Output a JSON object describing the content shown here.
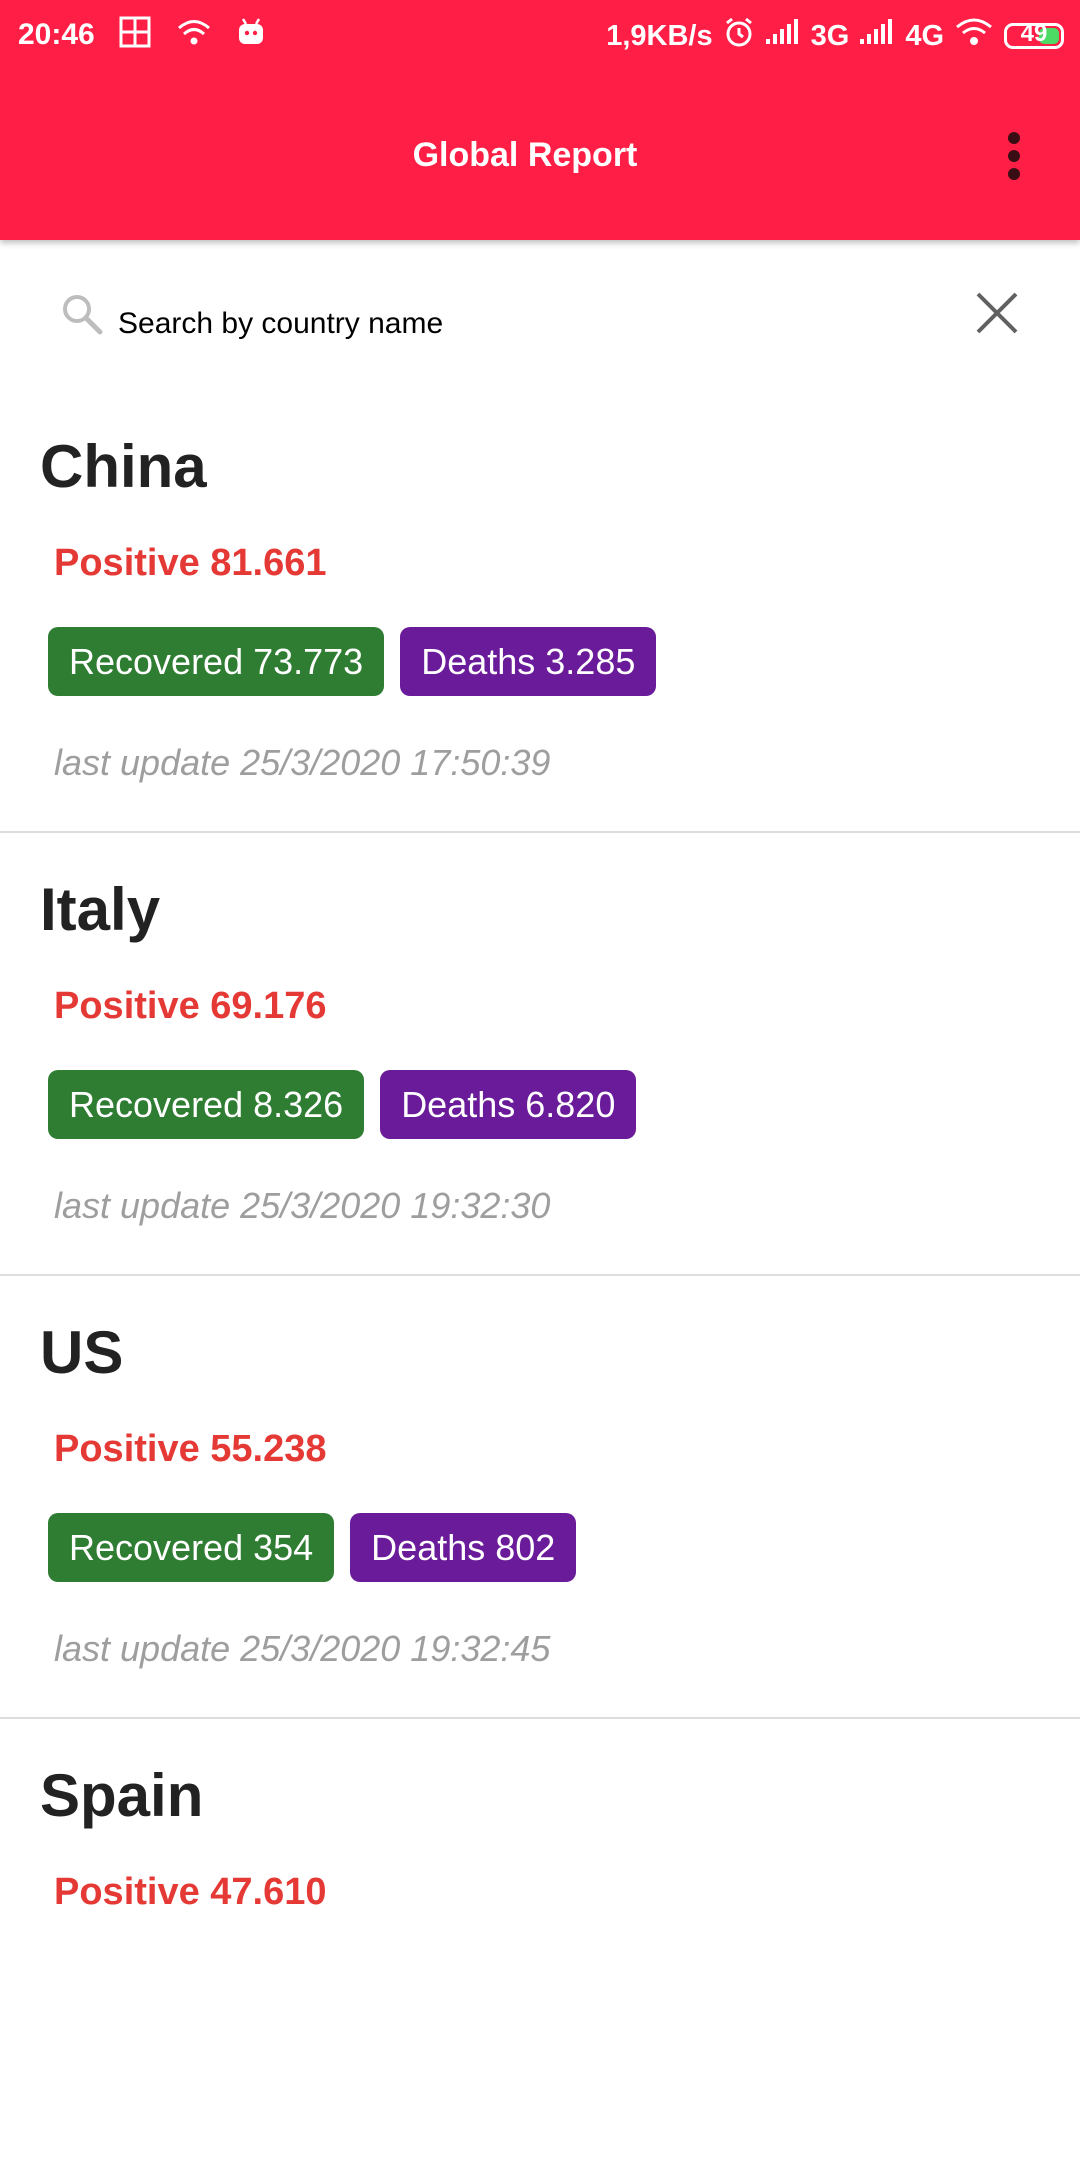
{
  "status_bar": {
    "time": "20:46",
    "net_speed": "1,9KB/s",
    "network_1": "3G",
    "network_2": "4G",
    "battery": "49",
    "battery_color": "#4cd964"
  },
  "app_bar": {
    "title": "Global Report",
    "background": "#ff1e46",
    "menu_icon": "more-vert-icon"
  },
  "search": {
    "placeholder": "Search by country name",
    "value": "",
    "search_icon": "search-icon",
    "clear_icon": "close-icon"
  },
  "colors": {
    "positive": "#e53935",
    "recovered": "#2e7d32",
    "deaths": "#6a1b9a",
    "last_update": "#9e9e9e"
  },
  "countries": [
    {
      "name": "China",
      "positive": "Positive 81.661",
      "recovered": "Recovered 73.773",
      "deaths": "Deaths 3.285",
      "last_update": "last update 25/3/2020 17:50:39"
    },
    {
      "name": "Italy",
      "positive": "Positive 69.176",
      "recovered": "Recovered 8.326",
      "deaths": "Deaths 6.820",
      "last_update": "last update 25/3/2020 19:32:30"
    },
    {
      "name": "US",
      "positive": "Positive 55.238",
      "recovered": "Recovered 354",
      "deaths": "Deaths 802",
      "last_update": "last update 25/3/2020 19:32:45"
    },
    {
      "name": "Spain",
      "positive": "Positive 47.610"
    }
  ]
}
